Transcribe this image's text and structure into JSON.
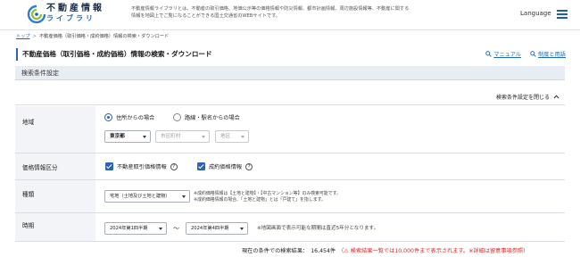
{
  "header": {
    "logo_main": "不動産情報",
    "logo_sub": "ライブラリ",
    "description_line1": "不動産情報ライブラリとは、不動産の取引価格、地価公示等の価格情報や防災情報、都市計画情報、周辺施設情報等、不動産に関する",
    "description_line2": "情報を地図上でご覧になることができる国土交通省のWEBサイトです。",
    "language_label": "Language",
    "menu_icon": "hamburger-menu-icon",
    "accent_color": "#1d5fa8"
  },
  "breadcrumb": {
    "home": "トップ",
    "current": "不動産価格（取引価格・成約価格）情報の検索・ダウンロード"
  },
  "page": {
    "title": "不動産価格（取引価格・成約価格）情報の検索・ダウンロード",
    "manual_link": "マニュアル",
    "terms_link": "制度と用語"
  },
  "search": {
    "section_title": "検索条件設定",
    "collapse_label": "検索条件設定を閉じる"
  },
  "area": {
    "label": "地域",
    "radio_address": "住所からの場合",
    "radio_station": "路線・駅名からの場合",
    "selected_radio": "address",
    "prefecture": "東京都",
    "city_placeholder": "市区町村",
    "district_placeholder": "地区"
  },
  "price_type": {
    "label": "価格情報区分",
    "transaction": "不動産取引価格情報",
    "contract": "成約価格情報",
    "transaction_checked": true,
    "contract_checked": true
  },
  "category": {
    "label": "種類",
    "selected": "宅地（土地及び土地と建物）",
    "note1": "※成約価格情報は【土地と建物】・【中古マンション等】のみ検索可能です。",
    "note2": "※成約価格情報の場合、「土地と建物」とは「戸建て」を指します。"
  },
  "period": {
    "label": "時期",
    "from": "2024年第1四半期",
    "separator": "～",
    "to": "2024年第4四半期",
    "note": "※地図画面で表示可能な期間は直近5年分となります。"
  },
  "result": {
    "prefix": "現在の条件での検索結果：",
    "count": "16,454件",
    "warning": "（⚠ 検索結果一覧では10,000件まで表示されます。※詳細は留意事項参照）",
    "warning_color": "#d32a2a"
  }
}
